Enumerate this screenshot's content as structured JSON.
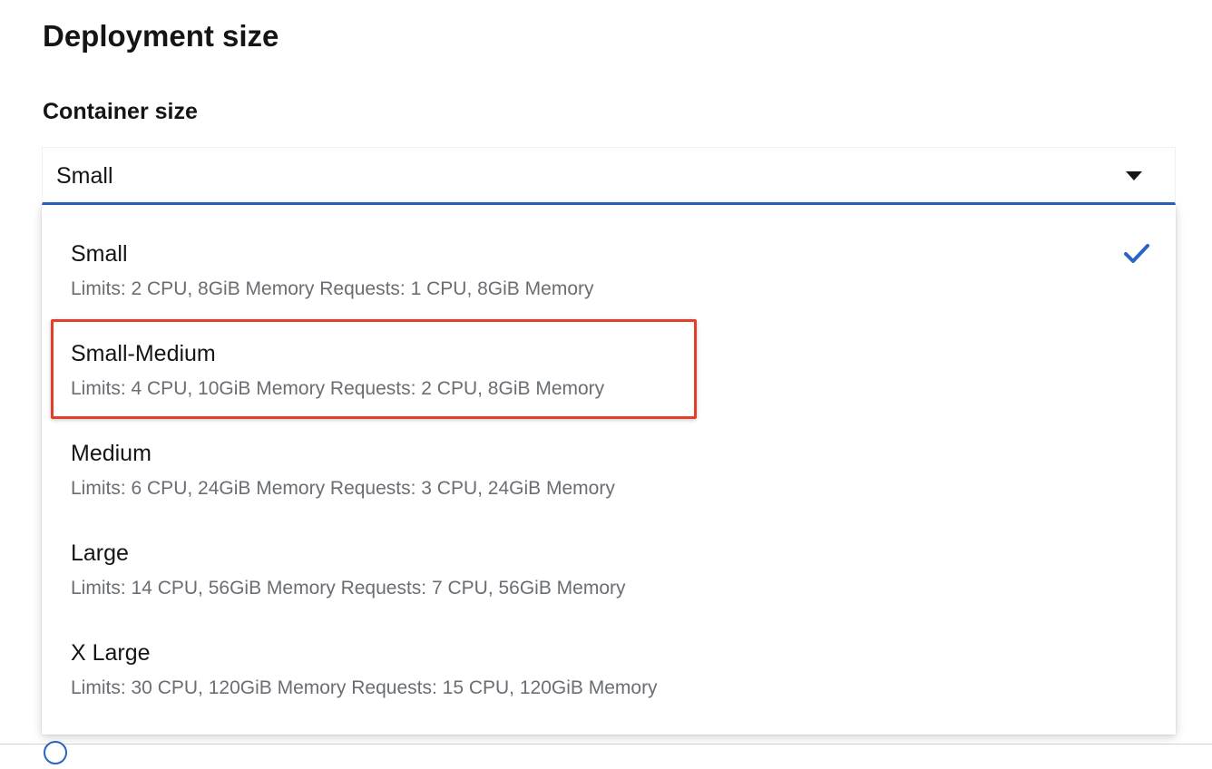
{
  "section": {
    "title": "Deployment size"
  },
  "container_size": {
    "label": "Container size",
    "selected": "Small",
    "options": [
      {
        "title": "Small",
        "description": "Limits: 2 CPU, 8GiB Memory Requests: 1 CPU, 8GiB Memory",
        "selected": true
      },
      {
        "title": "Small-Medium",
        "description": "Limits: 4 CPU, 10GiB Memory Requests: 2 CPU, 8GiB Memory",
        "selected": false
      },
      {
        "title": "Medium",
        "description": "Limits: 6 CPU, 24GiB Memory Requests: 3 CPU, 24GiB Memory",
        "selected": false
      },
      {
        "title": "Large",
        "description": "Limits: 14 CPU, 56GiB Memory Requests: 7 CPU, 56GiB Memory",
        "selected": false
      },
      {
        "title": "X Large",
        "description": "Limits: 30 CPU, 120GiB Memory Requests: 15 CPU, 120GiB Memory",
        "selected": false
      }
    ]
  },
  "colors": {
    "accent": "#2b63c6",
    "highlight": "#e0402a",
    "secondary_text": "#6a6e73"
  },
  "icons": {
    "toggle": "caret-down-icon",
    "selected": "check-icon",
    "below": "radio-icon"
  }
}
